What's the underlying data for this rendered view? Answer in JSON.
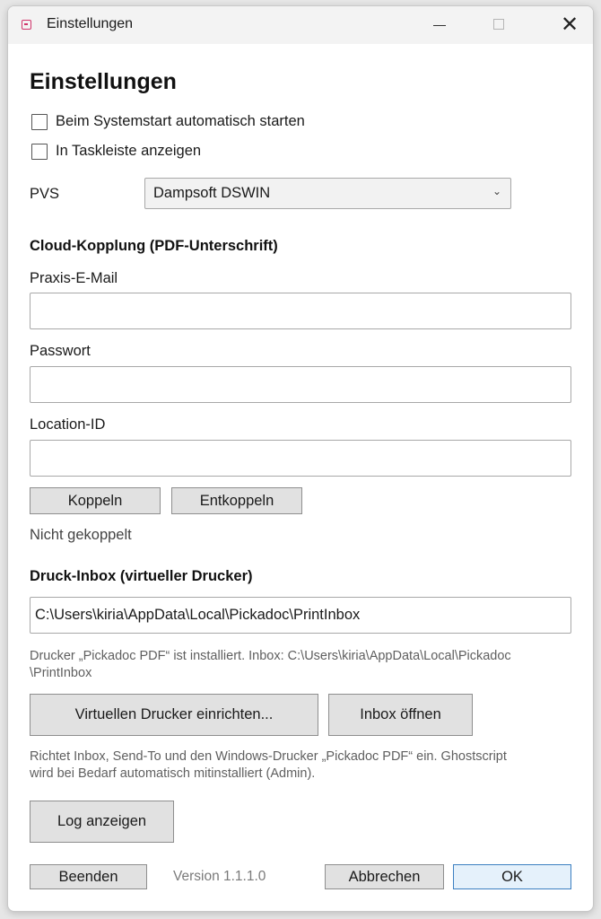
{
  "window": {
    "title": "Einstellungen",
    "minimize_label": "—",
    "close_label": "✕"
  },
  "page": {
    "heading": "Einstellungen"
  },
  "options": {
    "autostart_label": "Beim Systemstart automatisch starten",
    "autostart_checked": false,
    "taskbar_label": "In Taskleiste anzeigen",
    "taskbar_checked": false
  },
  "pvs": {
    "label": "PVS",
    "selected": "Dampsoft DSWIN",
    "chevron": "⌄"
  },
  "cloud": {
    "heading": "Cloud-Kopplung (PDF-Unterschrift)",
    "email_label": "Praxis-E-Mail",
    "email_value": "",
    "password_label": "Passwort",
    "password_value": "",
    "location_label": "Location-ID",
    "location_value": "",
    "couple_button": "Koppeln",
    "decouple_button": "Entkoppeln",
    "status": "Nicht gekoppelt"
  },
  "print_inbox": {
    "heading": "Druck-Inbox (virtueller Drucker)",
    "path_value": "C:\\Users\\kiria\\AppData\\Local\\Pickadoc\\PrintInbox",
    "info_line1": "Drucker „Pickadoc PDF“ ist installiert. Inbox: C:\\Users\\kiria\\AppData\\Local\\Pickadoc",
    "info_line2": "\\PrintInbox",
    "setup_button": "Virtuellen Drucker einrichten...",
    "open_button": "Inbox öffnen",
    "help_line1": "Richtet Inbox, Send-To und den Windows-Drucker „Pickadoc PDF“ ein. Ghostscript",
    "help_line2": "wird bei Bedarf automatisch mitinstalliert (Admin)."
  },
  "log_button": "Log anzeigen",
  "footer": {
    "quit_button": "Beenden",
    "version": "Version 1.1.1.0",
    "cancel_button": "Abbrechen",
    "ok_button": "OK"
  },
  "colors": {
    "accent_icon": "#d1356b",
    "primary_button_border": "#3c7fc1"
  },
  "icons": {
    "app": "app-icon",
    "minimize": "minimize-icon",
    "maximize": "maximize-icon",
    "close": "close-icon",
    "dropdown": "chevron-down-icon"
  }
}
